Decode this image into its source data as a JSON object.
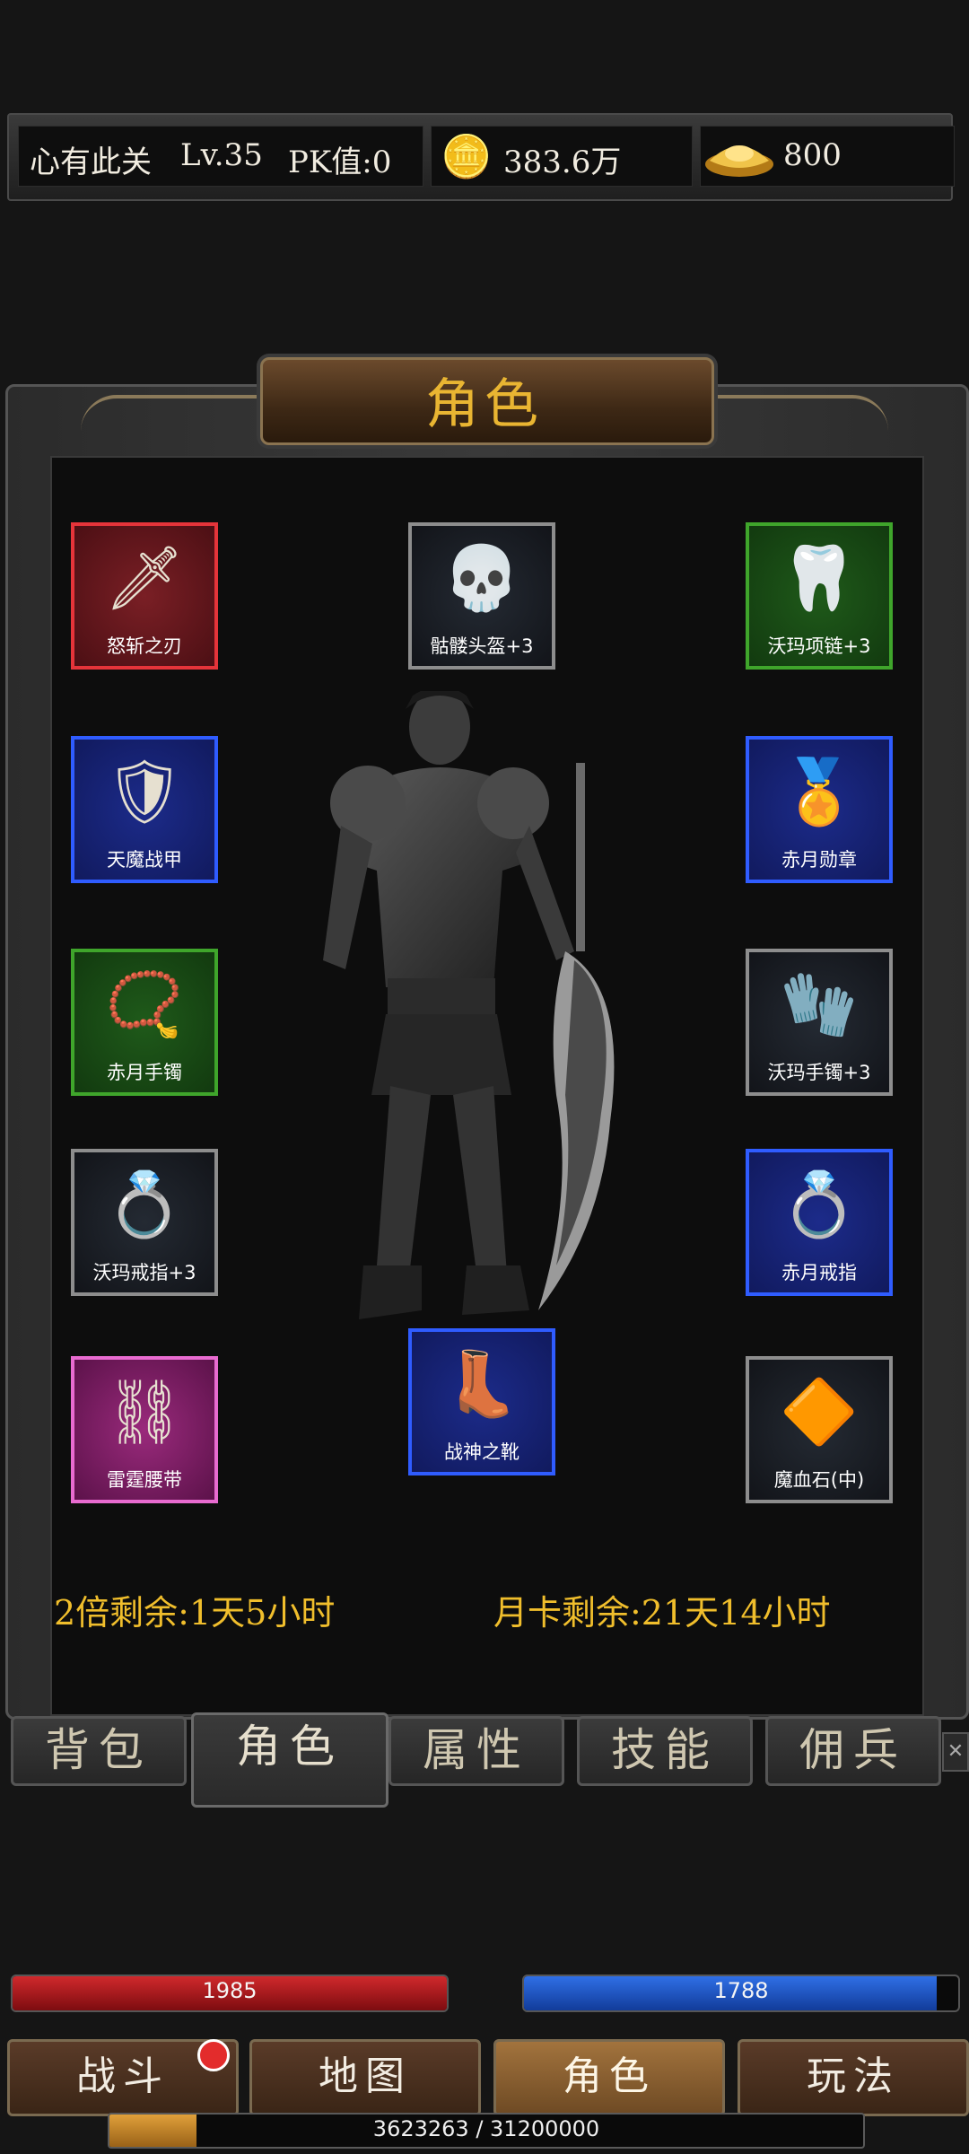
{
  "status": {
    "name": "心有此关",
    "level": "Lv.35",
    "pk": "PK值:0",
    "gold": "383.6万",
    "ingot": "800"
  },
  "panel": {
    "title": "角色"
  },
  "equipment": [
    {
      "label": "怒斩之刃",
      "icon": "🗡",
      "quality": "red"
    },
    {
      "label": "骷髅头盔+3",
      "icon": "💀",
      "quality": "gray"
    },
    {
      "label": "沃玛项链+3",
      "icon": "🦷",
      "quality": "green"
    },
    {
      "label": "天魔战甲",
      "icon": "🛡",
      "quality": "blue"
    },
    {
      "label": "赤月勋章",
      "icon": "🏅",
      "quality": "blue"
    },
    {
      "label": "赤月手镯",
      "icon": "📿",
      "quality": "green"
    },
    {
      "label": "沃玛手镯+3",
      "icon": "🧤",
      "quality": "gray"
    },
    {
      "label": "沃玛戒指+3",
      "icon": "💍",
      "quality": "gray"
    },
    {
      "label": "赤月戒指",
      "icon": "💍",
      "quality": "blue"
    },
    {
      "label": "雷霆腰带",
      "icon": "⛓",
      "quality": "pink"
    },
    {
      "label": "战神之靴",
      "icon": "👢",
      "quality": "blue"
    },
    {
      "label": "魔血石(中)",
      "icon": "🔶",
      "quality": "gray"
    }
  ],
  "remain": {
    "double": "2倍剩余:1天5小时",
    "monthcard": "月卡剩余:21天14小时"
  },
  "tabs": [
    "背包",
    "角色",
    "属性",
    "技能",
    "佣兵"
  ],
  "hp": {
    "value": "1985",
    "fill": 1.0
  },
  "mp": {
    "value": "1788",
    "fill": 0.95
  },
  "nav": [
    "战斗",
    "地图",
    "角色",
    "玩法"
  ],
  "xp": {
    "text": "3623263 / 31200000",
    "fill": 0.116
  }
}
